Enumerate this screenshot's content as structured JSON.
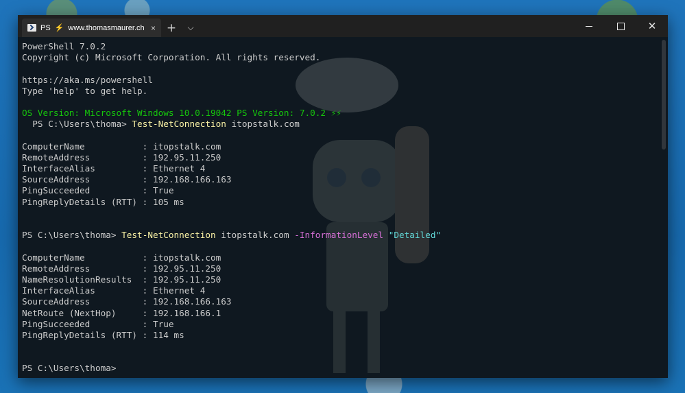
{
  "window": {
    "tab_prefix": "PS",
    "tab_title": "www.thomasmaurer.ch",
    "tab_close": "×",
    "new_tab": "+",
    "dropdown": "⌵",
    "close_glyph": "✕"
  },
  "console": {
    "l1": "PowerShell 7.0.2",
    "l2": "Copyright (c) Microsoft Corporation. All rights reserved.",
    "l3": "",
    "l4": "https://aka.ms/powershell",
    "l5": "Type 'help' to get help.",
    "os_line": "OS Version: Microsoft Windows 10.0.19042 PS Version: 7.0.2 ⚡⚡",
    "prompt1": "  PS C:\\Users\\thoma> ",
    "cmd1": "Test-NetConnection",
    "arg1": " itopstalk.com",
    "r1": [
      "ComputerName           : itopstalk.com",
      "RemoteAddress          : 192.95.11.250",
      "InterfaceAlias         : Ethernet 4",
      "SourceAddress          : 192.168.166.163",
      "PingSucceeded          : True",
      "PingReplyDetails (RTT) : 105 ms"
    ],
    "prompt2": "PS C:\\Users\\thoma> ",
    "cmd2": "Test-NetConnection",
    "arg2": " itopstalk.com ",
    "param2": "-InformationLevel",
    "str2": "\"Detailed\"",
    "r2": [
      "ComputerName           : itopstalk.com",
      "RemoteAddress          : 192.95.11.250",
      "NameResolutionResults  : 192.95.11.250",
      "InterfaceAlias         : Ethernet 4",
      "SourceAddress          : 192.168.166.163",
      "NetRoute (NextHop)     : 192.168.166.1",
      "PingSucceeded          : True",
      "PingReplyDetails (RTT) : 114 ms"
    ],
    "prompt3": "PS C:\\Users\\thoma>"
  },
  "colors": {
    "background": "#0f1820",
    "foreground": "#cccccc",
    "os_line": "#16c60c",
    "command": "#f9f1a5",
    "parameter": "#d670d6",
    "string": "#61d6d6"
  }
}
